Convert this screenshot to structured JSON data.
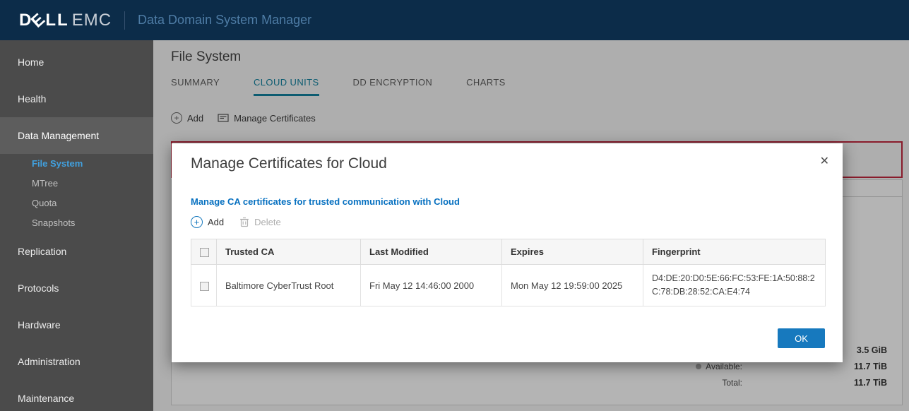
{
  "header": {
    "brand": {
      "d": "D",
      "e": "E",
      "ll": "LL",
      "emc": "EMC"
    },
    "app_title": "Data Domain System Manager"
  },
  "sidebar": {
    "items": [
      {
        "label": "Home"
      },
      {
        "label": "Health"
      },
      {
        "label": "Data Management",
        "active": true
      },
      {
        "label": "Replication"
      },
      {
        "label": "Protocols"
      },
      {
        "label": "Hardware"
      },
      {
        "label": "Administration"
      },
      {
        "label": "Maintenance"
      }
    ],
    "sub_items": [
      {
        "label": "File System",
        "active": true
      },
      {
        "label": "MTree"
      },
      {
        "label": "Quota"
      },
      {
        "label": "Snapshots"
      }
    ]
  },
  "main": {
    "page_title": "File System",
    "tabs": [
      {
        "label": "SUMMARY",
        "active": false
      },
      {
        "label": "CLOUD UNITS",
        "active": true
      },
      {
        "label": "DD ENCRYPTION",
        "active": false
      },
      {
        "label": "CHARTS",
        "active": false
      }
    ],
    "toolbar": {
      "add_label": "Add",
      "manage_certificates_label": "Manage Certificates"
    },
    "stats": {
      "used_value": "3.5 GiB",
      "available_label": "Available:",
      "available_value": "11.7 TiB",
      "total_label": "Total:",
      "total_value": "11.7 TiB"
    }
  },
  "modal": {
    "title": "Manage Certificates for Cloud",
    "description": "Manage CA certificates for trusted communication with Cloud",
    "toolbar": {
      "add_label": "Add",
      "delete_label": "Delete"
    },
    "table": {
      "columns": [
        "Trusted CA",
        "Last Modified",
        "Expires",
        "Fingerprint"
      ],
      "rows": [
        {
          "trusted_ca": "Baltimore CyberTrust Root",
          "last_modified": "Fri May 12 14:46:00 2000",
          "expires": "Mon May 12 19:59:00 2025",
          "fingerprint": "D4:DE:20:D0:5E:66:FC:53:FE:1A:50:88:2C:78:DB:28:52:CA:E4:74"
        }
      ]
    },
    "ok_label": "OK"
  },
  "icons": {
    "plus": "+",
    "close": "✕"
  },
  "colors": {
    "header_bg": "#0C2C49",
    "sidebar_bg": "#4B4B4B",
    "active_tab": "#0C7D9B",
    "accent_blue": "#1779BE",
    "link_blue": "#0670C0",
    "alert_red": "#BE2138",
    "active_nav_link": "#41A0DE"
  }
}
